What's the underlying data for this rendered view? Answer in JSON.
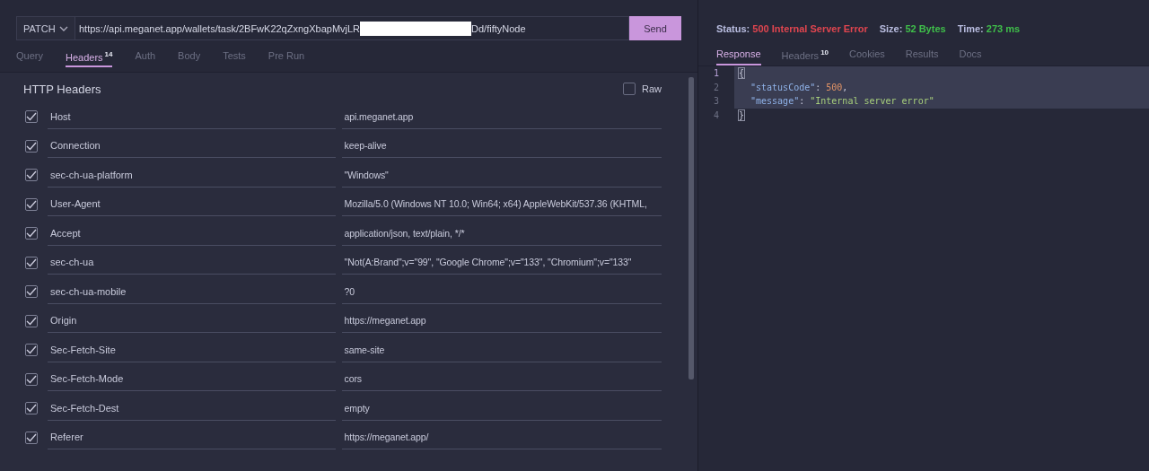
{
  "request": {
    "method": "PATCH",
    "url_start": "https://api.meganet.app/wallets/task/2BFwK22qZxngXbapMvjLR",
    "url_redacted": true,
    "url_end": "Dd/fiftyNode",
    "send": "Send"
  },
  "request_tabs": [
    {
      "label": "Query",
      "selected": false
    },
    {
      "label": "Headers",
      "count": "14",
      "selected": true
    },
    {
      "label": "Auth",
      "selected": false
    },
    {
      "label": "Body",
      "selected": false
    },
    {
      "label": "Tests",
      "selected": false
    },
    {
      "label": "Pre Run",
      "selected": false
    }
  ],
  "headers_panel": {
    "title": "HTTP Headers",
    "raw_label": "Raw",
    "raw_checked": false,
    "rows": [
      {
        "name": "Host",
        "value": "api.meganet.app",
        "checked": true
      },
      {
        "name": "Connection",
        "value": "keep-alive",
        "checked": true
      },
      {
        "name": "sec-ch-ua-platform",
        "value": "\"Windows\"",
        "checked": true
      },
      {
        "name": "User-Agent",
        "value": "Mozilla/5.0 (Windows NT 10.0; Win64; x64) AppleWebKit/537.36 (KHTML,",
        "checked": true
      },
      {
        "name": "Accept",
        "value": "application/json, text/plain, */*",
        "checked": true
      },
      {
        "name": "sec-ch-ua",
        "value": "\"Not(A:Brand\";v=\"99\", \"Google Chrome\";v=\"133\", \"Chromium\";v=\"133\"",
        "checked": true
      },
      {
        "name": "sec-ch-ua-mobile",
        "value": "?0",
        "checked": true
      },
      {
        "name": "Origin",
        "value": "https://meganet.app",
        "checked": true
      },
      {
        "name": "Sec-Fetch-Site",
        "value": "same-site",
        "checked": true
      },
      {
        "name": "Sec-Fetch-Mode",
        "value": "cors",
        "checked": true
      },
      {
        "name": "Sec-Fetch-Dest",
        "value": "empty",
        "checked": true
      },
      {
        "name": "Referer",
        "value": "https://meganet.app/",
        "checked": true
      }
    ]
  },
  "status_line": [
    {
      "label": "Status:",
      "value": "500 Internal Server Error",
      "color": "#e0454f"
    },
    {
      "label": "Size:",
      "value": "52 Bytes",
      "color": "#3fbf4a"
    },
    {
      "label": "Time:",
      "value": "273 ms",
      "color": "#3fbf4a"
    }
  ],
  "response_tabs": [
    {
      "label": "Response",
      "selected": true
    },
    {
      "label": "Headers",
      "count": "10",
      "selected": false
    },
    {
      "label": "Cookies",
      "selected": false
    },
    {
      "label": "Results",
      "selected": false
    },
    {
      "label": "Docs",
      "selected": false
    }
  ],
  "response_body": [
    {
      "number": "1",
      "highlighted": true,
      "tokens": [
        {
          "kind": "bracket",
          "text": "{"
        }
      ]
    },
    {
      "number": "2",
      "highlighted": true,
      "tokens": [
        {
          "kind": "key",
          "text": "\"statusCode\""
        },
        {
          "kind": "punct",
          "text": ": "
        },
        {
          "kind": "number",
          "text": "500"
        },
        {
          "kind": "punct",
          "text": ","
        }
      ]
    },
    {
      "number": "3",
      "highlighted": true,
      "tokens": [
        {
          "kind": "key",
          "text": "\"message\""
        },
        {
          "kind": "punct",
          "text": ": "
        },
        {
          "kind": "string",
          "text": "\"Internal server error\""
        }
      ]
    },
    {
      "number": "4",
      "highlighted": false,
      "tokens": [
        {
          "kind": "bracket",
          "text": "}"
        }
      ]
    }
  ]
}
